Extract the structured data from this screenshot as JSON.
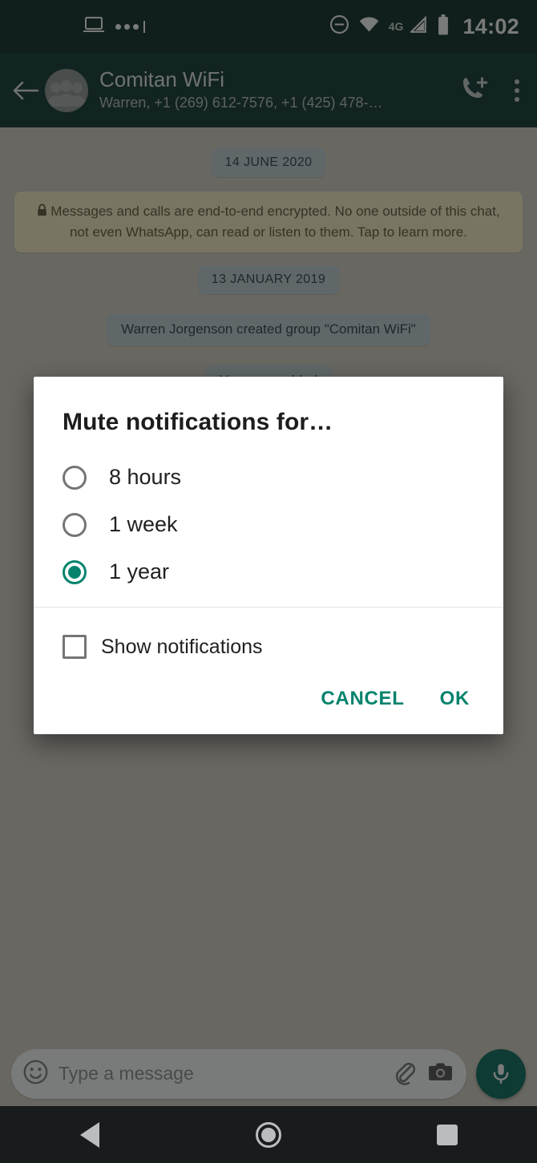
{
  "status_bar": {
    "time": "14:02",
    "network_label": "4G",
    "left_icons": [
      "laptop-icon",
      "more-notifications-icon"
    ],
    "right_icons": [
      "do-not-disturb-icon",
      "wifi-icon",
      "mobile-signal-icon",
      "battery-icon"
    ]
  },
  "toolbar": {
    "back_label": "Back",
    "chat_title": "Comitan WiFi",
    "chat_subtitle": "Warren, +1 (269) 612-7576, +1 (425) 478-…",
    "video_call_label": "Add call",
    "overflow_label": "More options"
  },
  "chat": {
    "date_chip_1": "14 JUNE 2020",
    "encryption_notice": "Messages and calls are end-to-end encrypted. No one outside of this chat, not even WhatsApp, can read or listen to them. Tap to learn more.",
    "date_chip_2": "13 JANUARY 2019",
    "system_message_1": "Warren Jorgenson created group \"Comitan WiFi\"",
    "system_message_2": "You were added"
  },
  "input_bar": {
    "placeholder": "Type a message",
    "emoji_label": "Emoji",
    "attach_label": "Attach",
    "camera_label": "Camera",
    "mic_label": "Voice message"
  },
  "dialog": {
    "title": "Mute notifications for…",
    "options": [
      {
        "label": "8 hours",
        "selected": false
      },
      {
        "label": "1 week",
        "selected": false
      },
      {
        "label": "1 year",
        "selected": true
      }
    ],
    "checkbox_label": "Show notifications",
    "checkbox_checked": false,
    "cancel_label": "CANCEL",
    "ok_label": "OK",
    "accent_color": "#05836d"
  },
  "nav_bar": {
    "back_label": "Back",
    "home_label": "Home",
    "recents_label": "Recent apps"
  }
}
